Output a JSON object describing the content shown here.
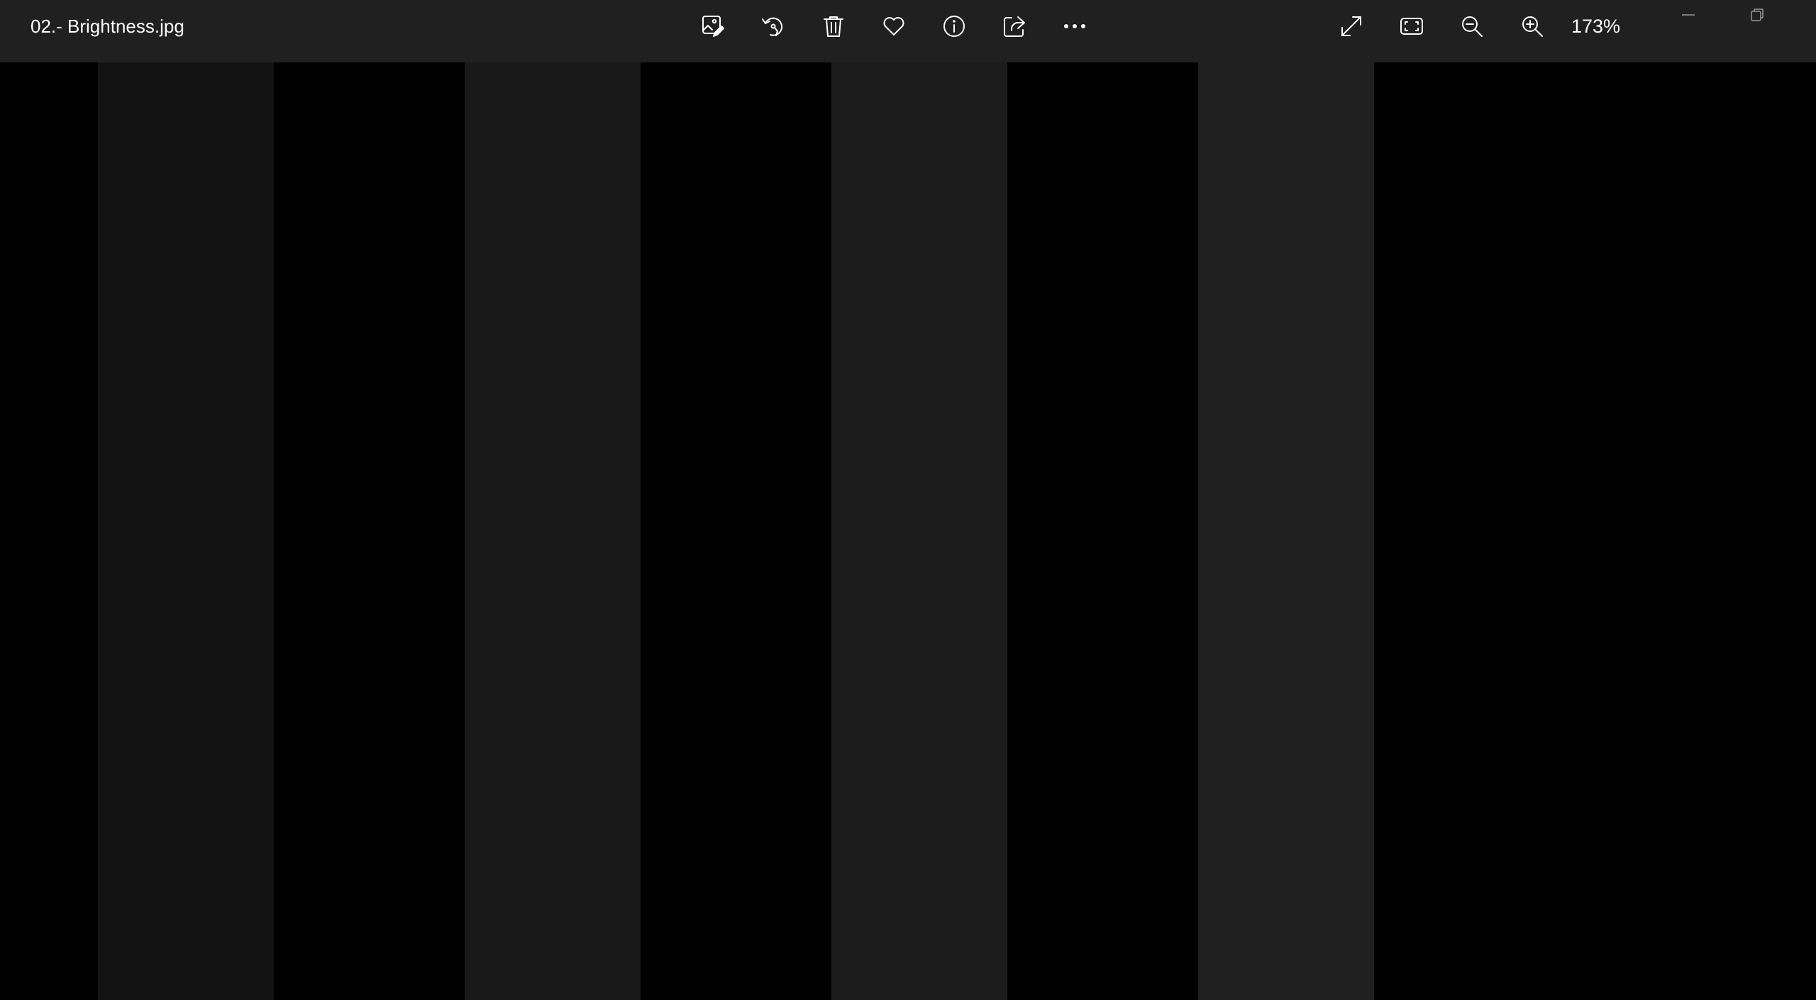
{
  "window": {
    "title": "02.- Brightness.jpg"
  },
  "toolbar": {
    "actions": [
      {
        "name": "edit-image-button",
        "icon": "edit-image-icon"
      },
      {
        "name": "rotate-button",
        "icon": "rotate-icon"
      },
      {
        "name": "delete-button",
        "icon": "trash-icon"
      },
      {
        "name": "favorite-button",
        "icon": "heart-icon"
      },
      {
        "name": "file-info-button",
        "icon": "info-icon"
      },
      {
        "name": "share-button",
        "icon": "share-icon"
      },
      {
        "name": "more-options-button",
        "icon": "more-icon"
      }
    ],
    "view_actions": [
      {
        "name": "full-screen-button",
        "icon": "expand-icon"
      },
      {
        "name": "fit-to-window-button",
        "icon": "fit-frame-icon"
      },
      {
        "name": "zoom-out-button",
        "icon": "zoom-out-icon"
      },
      {
        "name": "zoom-in-button",
        "icon": "zoom-in-icon"
      }
    ],
    "zoom_level": "173%"
  },
  "window_controls": {
    "minimize_icon": "minimize-icon",
    "restore_icon": "restore-icon"
  },
  "image": {
    "stripe_colors": [
      "#000000",
      "#131313",
      "#000000",
      "#191919",
      "#000000",
      "#1c1c1c",
      "#000000",
      "#202020",
      "#000000"
    ]
  },
  "colors": {
    "titlebar": "#202020",
    "icon": "#ffffff",
    "background": "#000000"
  }
}
